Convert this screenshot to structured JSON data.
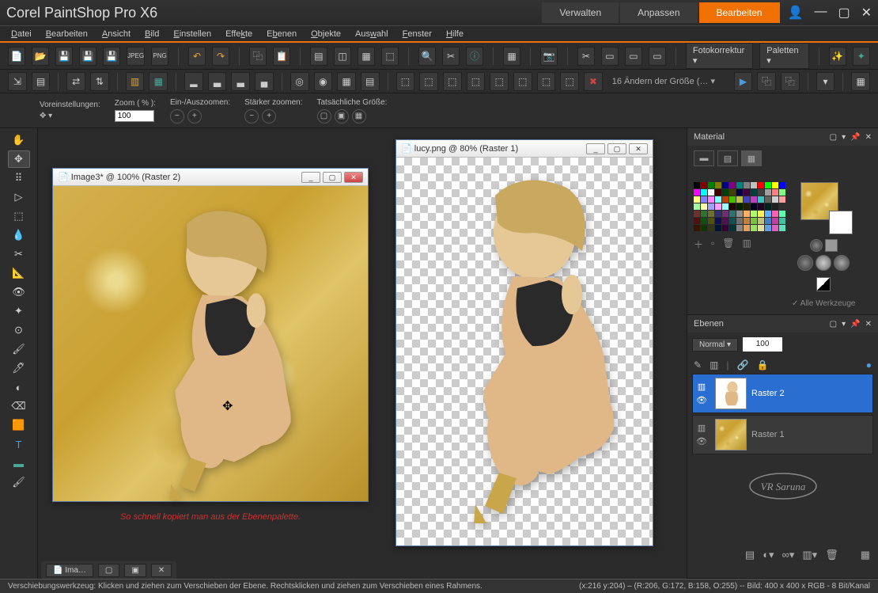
{
  "app": {
    "title": "Corel PaintShop Pro X6"
  },
  "workspace_tabs": [
    {
      "label": "Verwalten",
      "active": false
    },
    {
      "label": "Anpassen",
      "active": false
    },
    {
      "label": "Bearbeiten",
      "active": true
    }
  ],
  "menubar": [
    "Datei",
    "Bearbeiten",
    "Ansicht",
    "Bild",
    "Einstellen",
    "Effekte",
    "Ebenen",
    "Objekte",
    "Auswahl",
    "Fenster",
    "Hilfe"
  ],
  "toolbar_combos": {
    "fotokorrektur": "Fotokorrektur",
    "paletten": "Paletten"
  },
  "toolbar2_combo": "16 Ändern der Größe (…",
  "options": {
    "voreinstellungen_label": "Voreinstellungen:",
    "zoom_label": "Zoom ( % ):",
    "zoom_value": "100",
    "einaus_label": "Ein-/Auszoomen:",
    "staerker_label": "Stärker zoomen:",
    "tats_label": "Tatsächliche Größe:"
  },
  "documents": {
    "doc1": {
      "title": "Image3* @ 100% (Raster 2)"
    },
    "doc2": {
      "title": "lucy.png @  80% (Raster 1)"
    }
  },
  "caption": "So schnell kopiert man aus der Ebenenpalette.",
  "doctab": "Ima…",
  "panels": {
    "material": {
      "title": "Material",
      "all_tools": "Alle Werkzeuge"
    },
    "ebenen": {
      "title": "Ebenen",
      "blend_mode": "Normal",
      "opacity": "100",
      "layers": [
        {
          "name": "Raster 2",
          "selected": true
        },
        {
          "name": "Raster 1",
          "selected": false
        }
      ]
    }
  },
  "signature": "VR Saruna",
  "status": {
    "left": "Verschiebungswerkzeug: Klicken und ziehen zum Verschieben der Ebene. Rechtsklicken und ziehen zum Verschieben eines Rahmens.",
    "right": "(x:216 y:204) – (R:206, G:172, B:158, O:255) -- Bild:  400 x 400 x RGB - 8 Bit/Kanal"
  },
  "palette_colors": [
    "#000000",
    "#800000",
    "#008000",
    "#808000",
    "#000080",
    "#800080",
    "#008080",
    "#808080",
    "#c0c0c0",
    "#ff0000",
    "#00ff00",
    "#ffff00",
    "#0000ff",
    "#ff00ff",
    "#00ffff",
    "#ffffff",
    "#400000",
    "#004000",
    "#404000",
    "#000040",
    "#400040",
    "#004040",
    "#404040",
    "#a0a0a0",
    "#ff8080",
    "#80ff80",
    "#ffff80",
    "#8080ff",
    "#ff80ff",
    "#80ffff",
    "#c04000",
    "#40c000",
    "#c0c040",
    "#4040c0",
    "#c040c0",
    "#40c0c0",
    "#606060",
    "#d0d0d0",
    "#ffa0a0",
    "#a0ffa0",
    "#ffffb0",
    "#a0a0ff",
    "#ffa0ff",
    "#a0ffff",
    "#200000",
    "#002000",
    "#202000",
    "#000020",
    "#200020",
    "#002020",
    "#202020",
    "#303030",
    "#703030",
    "#307030",
    "#707030",
    "#303070",
    "#703070",
    "#307070",
    "#909090",
    "#ffb060",
    "#b0ff60",
    "#fff060",
    "#60b0ff",
    "#ff60b0",
    "#60ffb0",
    "#501010",
    "#105010",
    "#505010",
    "#101050",
    "#501050",
    "#105050",
    "#707070",
    "#c08040",
    "#80c040",
    "#c0c080",
    "#4080c0",
    "#c040a0",
    "#40c0a0",
    "#351500",
    "#153500",
    "#353515",
    "#001535",
    "#350035",
    "#003535",
    "#858585",
    "#e0a060",
    "#a0e060",
    "#e0e0a0",
    "#60a0e0",
    "#e060c0",
    "#60e0c0"
  ]
}
